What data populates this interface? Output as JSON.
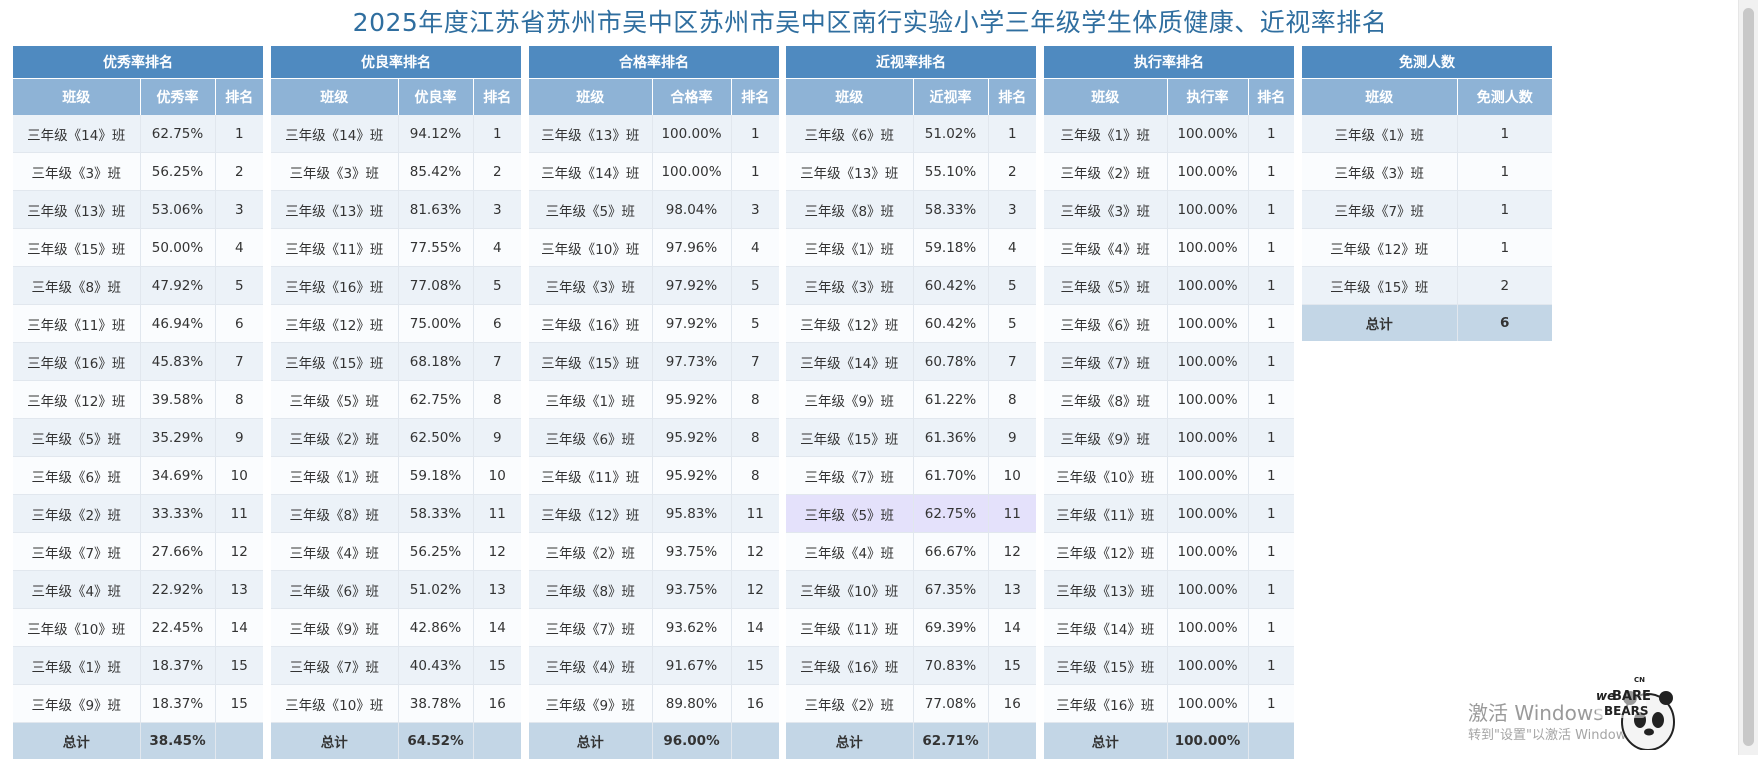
{
  "title": "2025年度江苏省苏州市吴中区苏州市吴中区南行实验小学三年级学生体质健康、近视率排名",
  "tables": [
    {
      "header": "优秀率排名",
      "columns": [
        "班级",
        "优秀率",
        "排名"
      ],
      "rows": [
        [
          "三年级《14》班",
          "62.75%",
          "1"
        ],
        [
          "三年级《3》班",
          "56.25%",
          "2"
        ],
        [
          "三年级《13》班",
          "53.06%",
          "3"
        ],
        [
          "三年级《15》班",
          "50.00%",
          "4"
        ],
        [
          "三年级《8》班",
          "47.92%",
          "5"
        ],
        [
          "三年级《11》班",
          "46.94%",
          "6"
        ],
        [
          "三年级《16》班",
          "45.83%",
          "7"
        ],
        [
          "三年级《12》班",
          "39.58%",
          "8"
        ],
        [
          "三年级《5》班",
          "35.29%",
          "9"
        ],
        [
          "三年级《6》班",
          "34.69%",
          "10"
        ],
        [
          "三年级《2》班",
          "33.33%",
          "11"
        ],
        [
          "三年级《7》班",
          "27.66%",
          "12"
        ],
        [
          "三年级《4》班",
          "22.92%",
          "13"
        ],
        [
          "三年级《10》班",
          "22.45%",
          "14"
        ],
        [
          "三年级《1》班",
          "18.37%",
          "15"
        ],
        [
          "三年级《9》班",
          "18.37%",
          "15"
        ]
      ],
      "total": [
        "总计",
        "38.45%",
        ""
      ]
    },
    {
      "header": "优良率排名",
      "columns": [
        "班级",
        "优良率",
        "排名"
      ],
      "rows": [
        [
          "三年级《14》班",
          "94.12%",
          "1"
        ],
        [
          "三年级《3》班",
          "85.42%",
          "2"
        ],
        [
          "三年级《13》班",
          "81.63%",
          "3"
        ],
        [
          "三年级《11》班",
          "77.55%",
          "4"
        ],
        [
          "三年级《16》班",
          "77.08%",
          "5"
        ],
        [
          "三年级《12》班",
          "75.00%",
          "6"
        ],
        [
          "三年级《15》班",
          "68.18%",
          "7"
        ],
        [
          "三年级《5》班",
          "62.75%",
          "8"
        ],
        [
          "三年级《2》班",
          "62.50%",
          "9"
        ],
        [
          "三年级《1》班",
          "59.18%",
          "10"
        ],
        [
          "三年级《8》班",
          "58.33%",
          "11"
        ],
        [
          "三年级《4》班",
          "56.25%",
          "12"
        ],
        [
          "三年级《6》班",
          "51.02%",
          "13"
        ],
        [
          "三年级《9》班",
          "42.86%",
          "14"
        ],
        [
          "三年级《7》班",
          "40.43%",
          "15"
        ],
        [
          "三年级《10》班",
          "38.78%",
          "16"
        ]
      ],
      "total": [
        "总计",
        "64.52%",
        ""
      ]
    },
    {
      "header": "合格率排名",
      "columns": [
        "班级",
        "合格率",
        "排名"
      ],
      "rows": [
        [
          "三年级《13》班",
          "100.00%",
          "1"
        ],
        [
          "三年级《14》班",
          "100.00%",
          "1"
        ],
        [
          "三年级《5》班",
          "98.04%",
          "3"
        ],
        [
          "三年级《10》班",
          "97.96%",
          "4"
        ],
        [
          "三年级《3》班",
          "97.92%",
          "5"
        ],
        [
          "三年级《16》班",
          "97.92%",
          "5"
        ],
        [
          "三年级《15》班",
          "97.73%",
          "7"
        ],
        [
          "三年级《1》班",
          "95.92%",
          "8"
        ],
        [
          "三年级《6》班",
          "95.92%",
          "8"
        ],
        [
          "三年级《11》班",
          "95.92%",
          "8"
        ],
        [
          "三年级《12》班",
          "95.83%",
          "11"
        ],
        [
          "三年级《2》班",
          "93.75%",
          "12"
        ],
        [
          "三年级《8》班",
          "93.75%",
          "12"
        ],
        [
          "三年级《7》班",
          "93.62%",
          "14"
        ],
        [
          "三年级《4》班",
          "91.67%",
          "15"
        ],
        [
          "三年级《9》班",
          "89.80%",
          "16"
        ]
      ],
      "total": [
        "总计",
        "96.00%",
        ""
      ]
    },
    {
      "header": "近视率排名",
      "columns": [
        "班级",
        "近视率",
        "排名"
      ],
      "highlight_row": 10,
      "rows": [
        [
          "三年级《6》班",
          "51.02%",
          "1"
        ],
        [
          "三年级《13》班",
          "55.10%",
          "2"
        ],
        [
          "三年级《8》班",
          "58.33%",
          "3"
        ],
        [
          "三年级《1》班",
          "59.18%",
          "4"
        ],
        [
          "三年级《3》班",
          "60.42%",
          "5"
        ],
        [
          "三年级《12》班",
          "60.42%",
          "5"
        ],
        [
          "三年级《14》班",
          "60.78%",
          "7"
        ],
        [
          "三年级《9》班",
          "61.22%",
          "8"
        ],
        [
          "三年级《15》班",
          "61.36%",
          "9"
        ],
        [
          "三年级《7》班",
          "61.70%",
          "10"
        ],
        [
          "三年级《5》班",
          "62.75%",
          "11"
        ],
        [
          "三年级《4》班",
          "66.67%",
          "12"
        ],
        [
          "三年级《10》班",
          "67.35%",
          "13"
        ],
        [
          "三年级《11》班",
          "69.39%",
          "14"
        ],
        [
          "三年级《16》班",
          "70.83%",
          "15"
        ],
        [
          "三年级《2》班",
          "77.08%",
          "16"
        ]
      ],
      "total": [
        "总计",
        "62.71%",
        ""
      ]
    },
    {
      "header": "执行率排名",
      "columns": [
        "班级",
        "执行率",
        "排名"
      ],
      "rows": [
        [
          "三年级《1》班",
          "100.00%",
          "1"
        ],
        [
          "三年级《2》班",
          "100.00%",
          "1"
        ],
        [
          "三年级《3》班",
          "100.00%",
          "1"
        ],
        [
          "三年级《4》班",
          "100.00%",
          "1"
        ],
        [
          "三年级《5》班",
          "100.00%",
          "1"
        ],
        [
          "三年级《6》班",
          "100.00%",
          "1"
        ],
        [
          "三年级《7》班",
          "100.00%",
          "1"
        ],
        [
          "三年级《8》班",
          "100.00%",
          "1"
        ],
        [
          "三年级《9》班",
          "100.00%",
          "1"
        ],
        [
          "三年级《10》班",
          "100.00%",
          "1"
        ],
        [
          "三年级《11》班",
          "100.00%",
          "1"
        ],
        [
          "三年级《12》班",
          "100.00%",
          "1"
        ],
        [
          "三年级《13》班",
          "100.00%",
          "1"
        ],
        [
          "三年级《14》班",
          "100.00%",
          "1"
        ],
        [
          "三年级《15》班",
          "100.00%",
          "1"
        ],
        [
          "三年级《16》班",
          "100.00%",
          "1"
        ]
      ],
      "total": [
        "总计",
        "100.00%",
        ""
      ]
    },
    {
      "header": "免测人数",
      "columns": [
        "班级",
        "免测人数"
      ],
      "rows": [
        [
          "三年级《1》班",
          "1"
        ],
        [
          "三年级《3》班",
          "1"
        ],
        [
          "三年级《7》班",
          "1"
        ],
        [
          "三年级《12》班",
          "1"
        ],
        [
          "三年级《15》班",
          "2"
        ]
      ],
      "total": [
        "总计",
        "6"
      ]
    }
  ],
  "watermark": {
    "line1": "激活 Windows",
    "line2": "转到\"设置\"以激活 Windows。",
    "logo_text": [
      "CN",
      "we",
      "BARE",
      "BEARS"
    ]
  },
  "colors": {
    "title": "#2f6e9f",
    "group_header": "#4f8ac0",
    "column_header": "#8eb3d6",
    "row_odd": "#ecf2f8",
    "row_even": "#fafcfe",
    "row_highlight": "#e4e1fb",
    "total_row": "#c3d6e6"
  }
}
